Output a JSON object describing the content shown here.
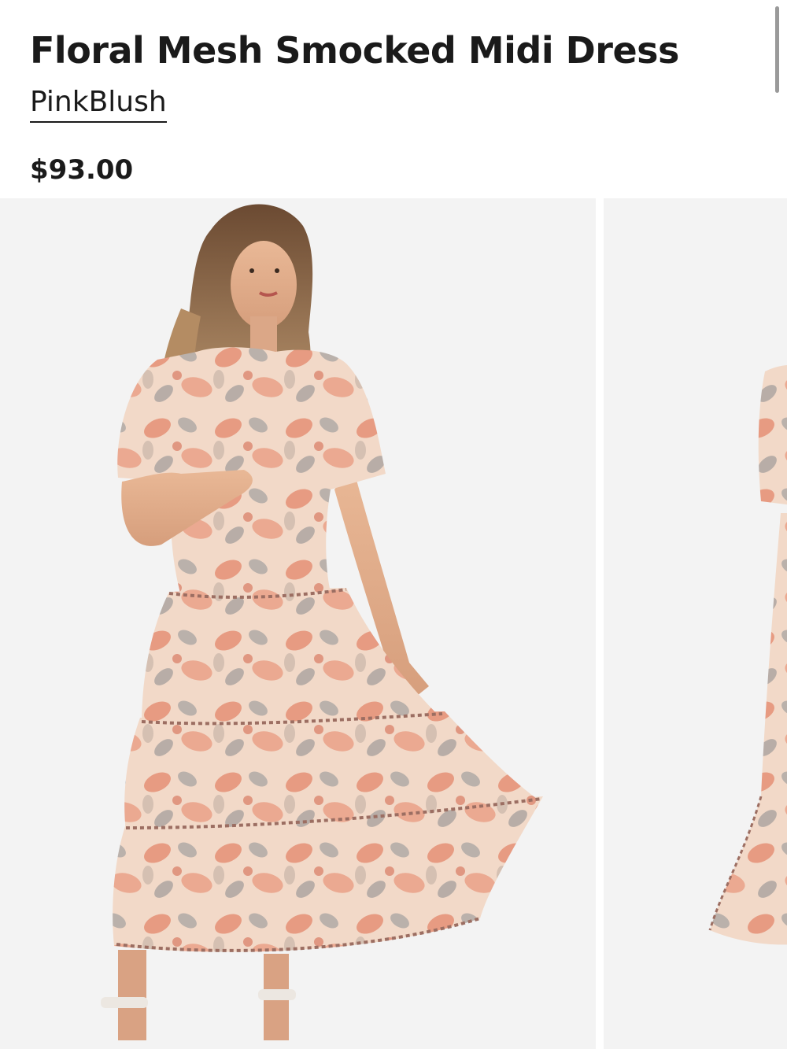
{
  "product": {
    "title": "Floral Mesh Smocked Midi Dress",
    "brand": "PinkBlush",
    "price": "$93.00"
  },
  "gallery": {
    "images": [
      {
        "description_icon": "model-photo-front"
      },
      {
        "description_icon": "model-photo-partial"
      }
    ]
  },
  "colors": {
    "background": "#ffffff",
    "photo_background": "#f3f3f3",
    "text": "#1a1a1a",
    "dress_base": "#f2d9c8",
    "floral_coral": "#e2866a",
    "floral_grey": "#8c8f94"
  }
}
